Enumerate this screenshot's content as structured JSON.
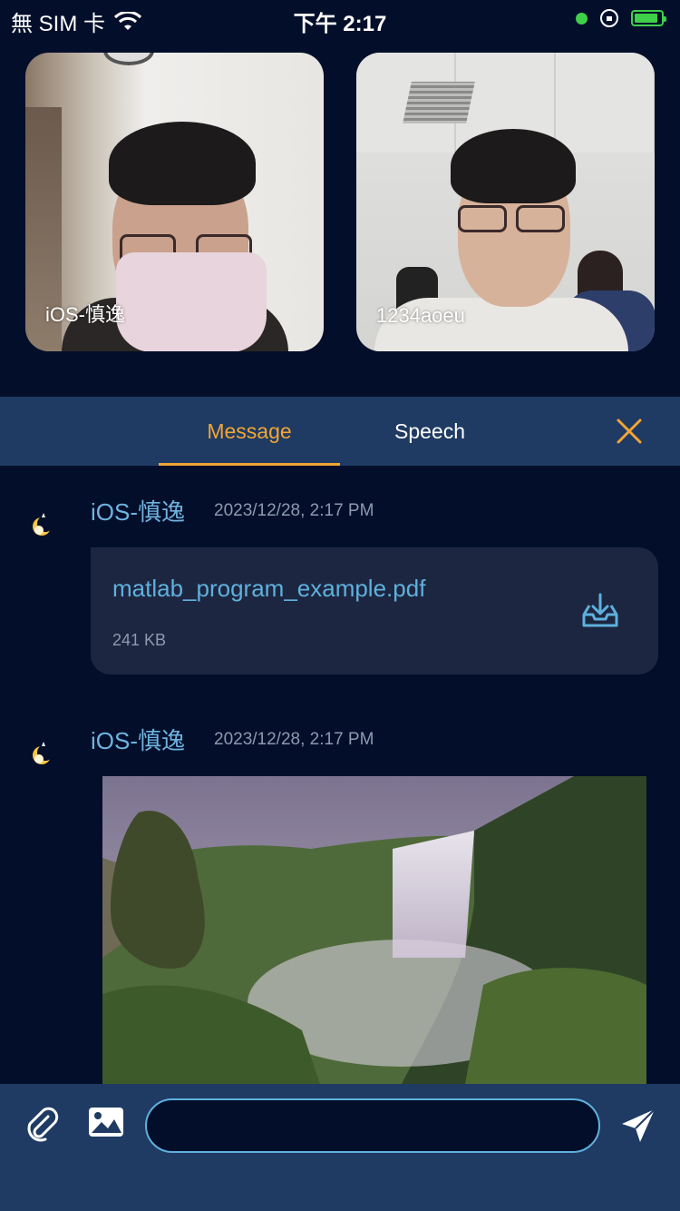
{
  "status_bar": {
    "carrier": "無 SIM 卡",
    "time": "下午 2:17",
    "battery_level": 0.9
  },
  "video_tiles": [
    {
      "name": "iOS-慎逸"
    },
    {
      "name": "1234aoeu"
    }
  ],
  "tabs": {
    "message": "Message",
    "speech": "Speech",
    "active": "message"
  },
  "messages": [
    {
      "sender": "iOS-慎逸",
      "time": "2023/12/28, 2:17 PM",
      "type": "file",
      "file_name": "matlab_program_example.pdf",
      "file_size": "241 KB"
    },
    {
      "sender": "iOS-慎逸",
      "time": "2023/12/28, 2:17 PM",
      "type": "image"
    }
  ],
  "input": {
    "value": "",
    "placeholder": ""
  },
  "colors": {
    "background": "#030f2a",
    "panel": "#1f3b63",
    "accent": "#f2a534",
    "link": "#5fb0dd",
    "meta": "#8d99ad"
  }
}
